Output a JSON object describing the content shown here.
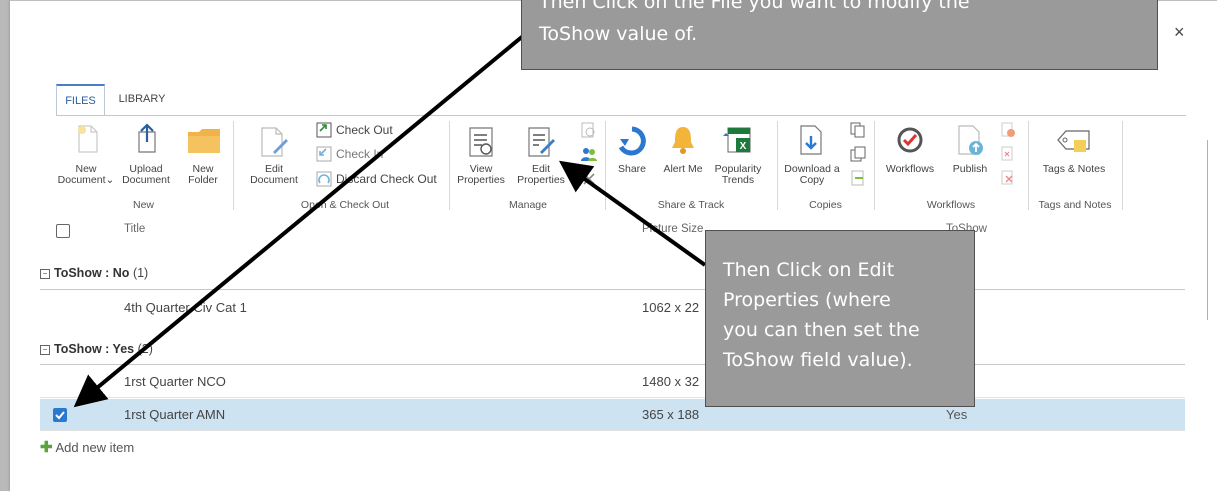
{
  "dialog": {
    "close_label": "×"
  },
  "ribbon": {
    "tabs": [
      {
        "label": "FILES",
        "active": true
      },
      {
        "label": "LIBRARY",
        "active": false
      }
    ],
    "buttons": {
      "new_document": "New Document",
      "new_document_arrow": "⌄",
      "upload_document": "Upload Document",
      "new_folder": "New Folder",
      "edit_document": "Edit Document",
      "check_out": "Check Out",
      "check_in": "Check In",
      "discard_check_out": "Discard Check Out",
      "view_properties": "View Properties",
      "edit_properties": "Edit Properties",
      "share": "Share",
      "alert_me": "Alert Me",
      "popularity_trends": "Popularity Trends",
      "download_copy": "Download a Copy",
      "workflows": "Workflows",
      "publish": "Publish",
      "tags_notes": "Tags & Notes"
    },
    "groups": {
      "new": "New",
      "open_checkout": "Open & Check Out",
      "manage": "Manage",
      "share_track": "Share & Track",
      "copies": "Copies",
      "workflows": "Workflows",
      "tags_notes": "Tags and Notes"
    }
  },
  "list": {
    "columns": {
      "title": "Title",
      "picture_size": "Picture Size",
      "toshow": "ToShow"
    },
    "groups": [
      {
        "label": "ToShow : No",
        "count": "(1)",
        "items": [
          {
            "title": "4th Quarter Civ Cat 1",
            "size": "1062 x 22",
            "toshow": "",
            "selected": false
          }
        ]
      },
      {
        "label": "ToShow : Yes",
        "count": "(2)",
        "items": [
          {
            "title": "1rst Quarter NCO",
            "size": "1480 x 32",
            "toshow": "",
            "selected": false
          },
          {
            "title": "1rst Quarter AMN",
            "size": "365 x 188",
            "toshow": "Yes",
            "selected": true
          }
        ]
      }
    ],
    "add_new_item": "Add new item"
  },
  "callouts": {
    "top": {
      "line1": "Then Click on the File you want to modify the",
      "line2": "ToShow value of."
    },
    "right": {
      "line1": "Then Click on Edit",
      "line2": "Properties (where",
      "line3": "you can then set the",
      "line4": "ToShow field value)."
    }
  },
  "colors": {
    "accent": "#2b78d0",
    "selected_row": "#cde3f2",
    "callout_fill": "#9a9a9a",
    "add_icon": "#5aa33d",
    "tab_accent": "#4a80c3"
  }
}
